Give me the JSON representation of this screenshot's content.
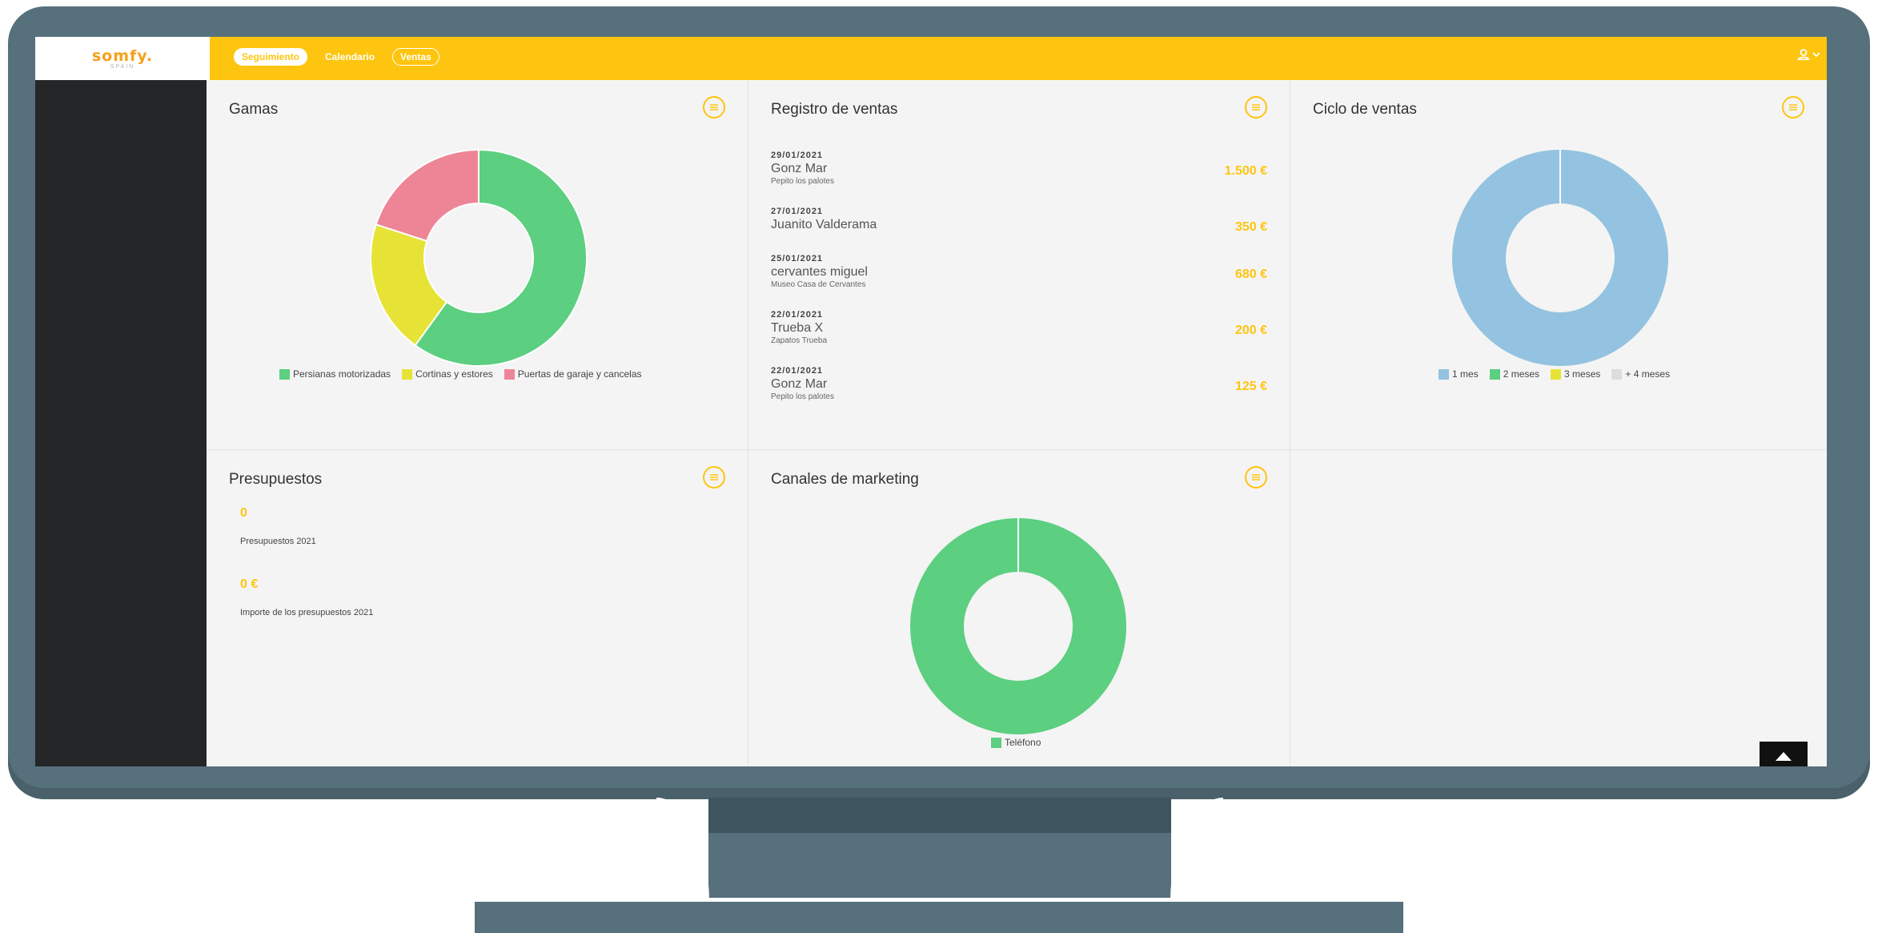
{
  "app": {
    "logo": "somfy.",
    "logo_sub": "SPAIN"
  },
  "nav": {
    "items": [
      {
        "label": "Seguimiento",
        "active": true
      },
      {
        "label": "Calendario",
        "active": false
      },
      {
        "label": "Ventas",
        "active": false
      }
    ]
  },
  "user_menu": {
    "icon": "user-icon",
    "caret": "chevron-down-icon"
  },
  "colors": {
    "accent": "#fec510",
    "green": "#5ccf80",
    "yellow": "#e6e336",
    "pink": "#ee8596",
    "blue": "#93c3e0",
    "grey": "#dddddd"
  },
  "panels": {
    "gamas": {
      "title": "Gamas",
      "menu_icon": "menu-lines-icon",
      "chart_data": {
        "type": "pie",
        "donut": true,
        "title": "Gamas",
        "slices": [
          {
            "label": "Persianas motorizadas",
            "value": 60,
            "color": "#5ccf80"
          },
          {
            "label": "Cortinas y estores",
            "value": 20,
            "color": "#e6e336"
          },
          {
            "label": "Puertas de garaje y cancelas",
            "value": 20,
            "color": "#ee8596"
          }
        ],
        "legend_position": "bottom"
      }
    },
    "registro": {
      "title": "Registro de ventas",
      "menu_icon": "menu-lines-icon",
      "sales": [
        {
          "date": "29/01/2021",
          "name": "Gonz Mar",
          "subtitle": "Pepito los palotes",
          "amount": "1.500 €"
        },
        {
          "date": "27/01/2021",
          "name": "Juanito Valderama",
          "subtitle": "",
          "amount": "350 €"
        },
        {
          "date": "25/01/2021",
          "name": "cervantes miguel",
          "subtitle": "Museo Casa de Cervantes",
          "amount": "680 €"
        },
        {
          "date": "22/01/2021",
          "name": "Trueba X",
          "subtitle": "Zapatos Trueba",
          "amount": "200 €"
        },
        {
          "date": "22/01/2021",
          "name": "Gonz Mar",
          "subtitle": "Pepito los palotes",
          "amount": "125 €"
        }
      ]
    },
    "ciclo": {
      "title": "Ciclo de ventas",
      "menu_icon": "menu-lines-icon",
      "chart_data": {
        "type": "pie",
        "donut": true,
        "title": "Ciclo de ventas",
        "slices": [
          {
            "label": "1 mes",
            "value": 100,
            "color": "#93c3e0"
          },
          {
            "label": "2 meses",
            "value": 0,
            "color": "#5ccf80"
          },
          {
            "label": "3 meses",
            "value": 0,
            "color": "#e6e336"
          },
          {
            "label": "+ 4 meses",
            "value": 0,
            "color": "#dddddd"
          }
        ],
        "legend_position": "bottom"
      }
    },
    "presupuestos": {
      "title": "Presupuestos",
      "menu_icon": "menu-lines-icon",
      "count_value": "0",
      "count_label": "Presupuestos 2021",
      "amount_value": "0 €",
      "amount_label": "Importe de los presupuestos 2021"
    },
    "canales": {
      "title": "Canales de marketing",
      "menu_icon": "menu-lines-icon",
      "chart_data": {
        "type": "pie",
        "donut": true,
        "title": "Canales de marketing",
        "slices": [
          {
            "label": "Teléfono",
            "value": 100,
            "color": "#5ccf80"
          }
        ],
        "legend_position": "bottom"
      }
    }
  },
  "scroll_top": {
    "icon": "arrow-up-icon"
  }
}
